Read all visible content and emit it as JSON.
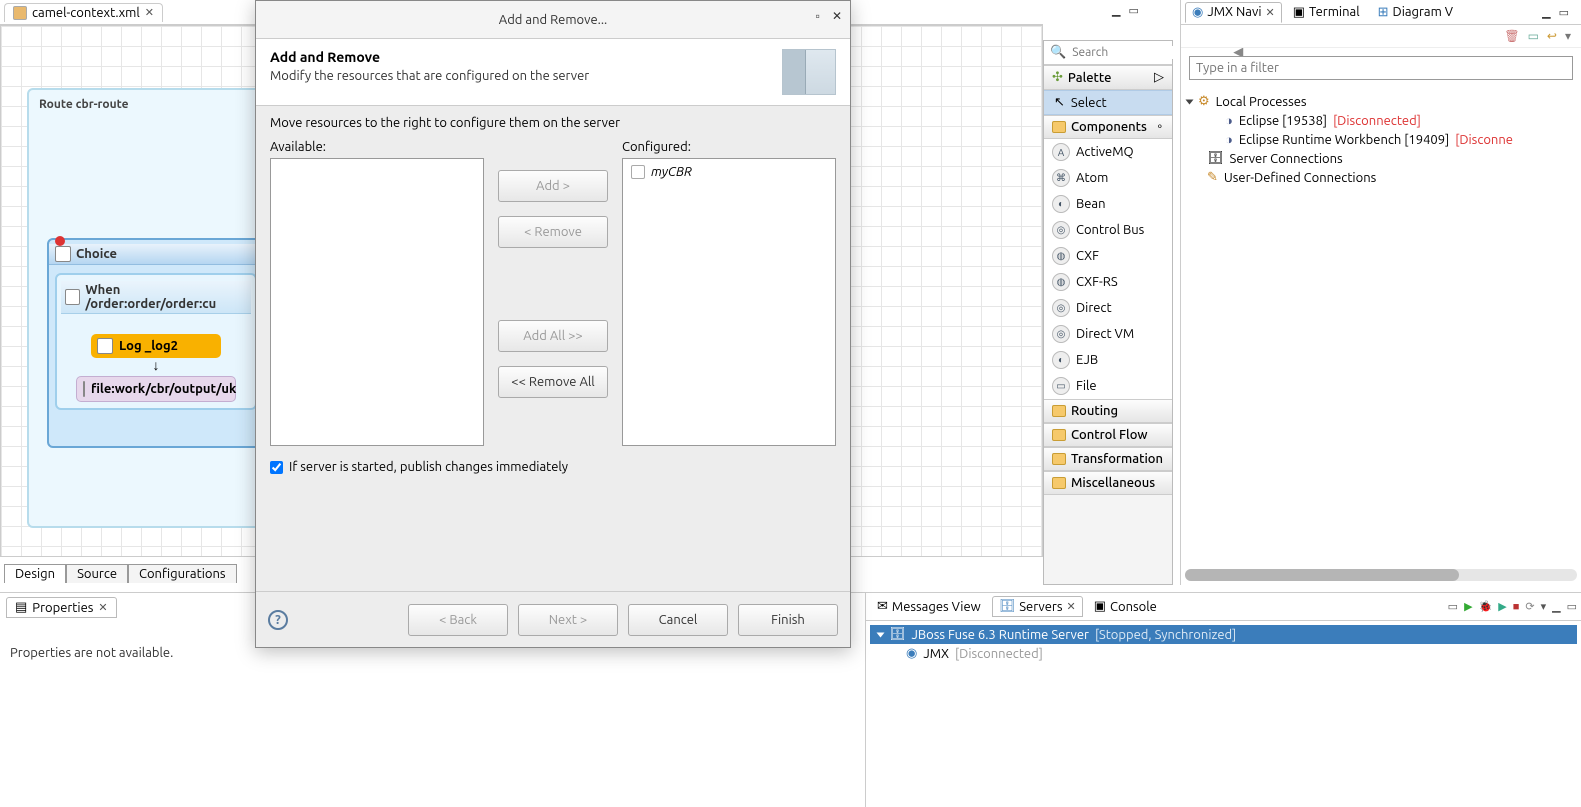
{
  "editor": {
    "tab_label": "camel-context.xml",
    "route_title": "Route cbr-route",
    "choice_label": "Choice",
    "when_label": "When /order:order/order:cu",
    "log_label": "Log _log2",
    "file_label": "file:work/cbr/output/uk",
    "bottom_tabs": {
      "design": "Design",
      "source": "Source",
      "config": "Configurations"
    }
  },
  "dialog": {
    "window_title": "Add and Remove...",
    "heading": "Add and Remove",
    "subheading": "Modify the resources that are configured on the server",
    "instruction": "Move resources to the right to configure them on the server",
    "available_label": "Available:",
    "configured_label": "Configured:",
    "configured_items": [
      "myCBR"
    ],
    "btn_add": "Add >",
    "btn_remove": "< Remove",
    "btn_add_all": "Add All >>",
    "btn_remove_all": "<< Remove All",
    "chk_label": "If server is started, publish changes immediately",
    "btn_back": "< Back",
    "btn_next": "Next >",
    "btn_cancel": "Cancel",
    "btn_finish": "Finish"
  },
  "palette": {
    "search_placeholder": "Search",
    "hdr_palette": "Palette",
    "select_label": "Select",
    "hdr_components": "Components",
    "items": [
      "ActiveMQ",
      "Atom",
      "Bean",
      "Control Bus",
      "CXF",
      "CXF-RS",
      "Direct",
      "Direct VM",
      "EJB",
      "File"
    ],
    "groups": {
      "routing": "Routing",
      "controlflow": "Control Flow",
      "transformation": "Transformation",
      "misc": "Miscellaneous"
    }
  },
  "jmx": {
    "tabs": {
      "jmx": "JMX Navi",
      "terminal": "Terminal",
      "diagram": "Diagram V"
    },
    "filter_placeholder": "Type in a filter",
    "tree": {
      "local": "Local Processes",
      "eclipse1": "Eclipse [19538]",
      "eclipse1_status": "[Disconnected]",
      "eclipse2": "Eclipse Runtime Workbench [19409]",
      "eclipse2_status": "[Disconne",
      "server_conn": "Server Connections",
      "user_conn": "User-Defined Connections"
    }
  },
  "servers": {
    "tabs": {
      "messages": "Messages View",
      "servers": "Servers",
      "console": "Console"
    },
    "row1": {
      "name": "JBoss Fuse 6.3 Runtime Server  ",
      "suffix": "[Stopped, Synchronized]"
    },
    "row2": {
      "name": "JMX",
      "suffix": "[Disconnected]"
    }
  },
  "props": {
    "tab": "Properties",
    "msg": "Properties are not available."
  }
}
